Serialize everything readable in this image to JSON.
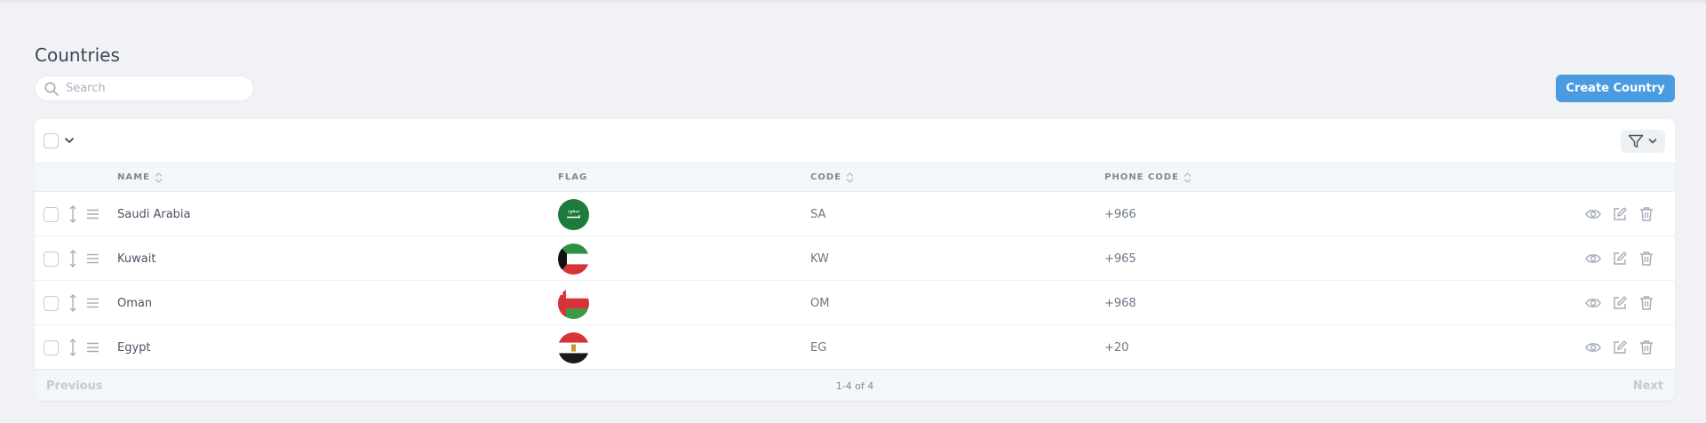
{
  "page": {
    "title": "Countries"
  },
  "search": {
    "placeholder": "Search",
    "value": ""
  },
  "actions": {
    "create_label": "Create Country"
  },
  "table": {
    "columns": {
      "name": "NAME",
      "flag": "FLAG",
      "code": "CODE",
      "phone_code": "PHONE CODE"
    },
    "rows": [
      {
        "name": "Saudi Arabia",
        "flag_icon": "saudi-arabia-flag",
        "code": "SA",
        "phone_code": "+966"
      },
      {
        "name": "Kuwait",
        "flag_icon": "kuwait-flag",
        "code": "KW",
        "phone_code": "+965"
      },
      {
        "name": "Oman",
        "flag_icon": "oman-flag",
        "code": "OM",
        "phone_code": "+968"
      },
      {
        "name": "Egypt",
        "flag_icon": "egypt-flag",
        "code": "EG",
        "phone_code": "+20"
      }
    ]
  },
  "pagination": {
    "previous": "Previous",
    "summary": "1-4 of 4",
    "next": "Next"
  },
  "colors": {
    "accent": "#4b9be0",
    "background": "#f0f2f5",
    "header_row": "#f4f7fa",
    "icon_muted": "#a3acb8"
  }
}
